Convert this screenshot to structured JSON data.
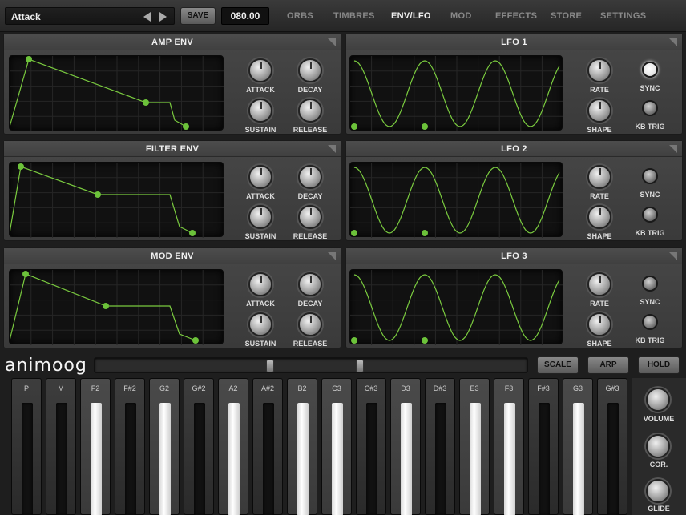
{
  "preset": {
    "name": "Attack"
  },
  "save_label": "SAVE",
  "bpm": "080.00",
  "tabs": [
    {
      "label": "ORBS",
      "active": false
    },
    {
      "label": "TIMBRES",
      "active": false
    },
    {
      "label": "ENV/LFO",
      "active": true
    },
    {
      "label": "MOD",
      "active": false
    },
    {
      "label": "EFFECTS",
      "active": false
    },
    {
      "label": "STORE",
      "active": false
    },
    {
      "label": "SETTINGS",
      "active": false
    }
  ],
  "envs": [
    {
      "title": "AMP ENV",
      "knobs": [
        "ATTACK",
        "DECAY",
        "SUSTAIN",
        "RELEASE"
      ]
    },
    {
      "title": "FILTER ENV",
      "knobs": [
        "ATTACK",
        "DECAY",
        "SUSTAIN",
        "RELEASE"
      ]
    },
    {
      "title": "MOD ENV",
      "knobs": [
        "ATTACK",
        "DECAY",
        "SUSTAIN",
        "RELEASE"
      ]
    }
  ],
  "lfos": [
    {
      "title": "LFO 1",
      "knobs": [
        "RATE",
        "SHAPE"
      ],
      "buttons": [
        "SYNC",
        "KB TRIG"
      ],
      "sync_on": true
    },
    {
      "title": "LFO 2",
      "knobs": [
        "RATE",
        "SHAPE"
      ],
      "buttons": [
        "SYNC",
        "KB TRIG"
      ],
      "sync_on": false
    },
    {
      "title": "LFO 3",
      "knobs": [
        "RATE",
        "SHAPE"
      ],
      "buttons": [
        "SYNC",
        "KB TRIG"
      ],
      "sync_on": false
    }
  ],
  "logo": "animoog Z",
  "bottom_buttons": [
    "SCALE",
    "ARP",
    "HOLD"
  ],
  "keys": [
    {
      "label": "P",
      "light": false
    },
    {
      "label": "M",
      "light": false
    },
    {
      "label": "F2",
      "light": true
    },
    {
      "label": "F#2",
      "light": false
    },
    {
      "label": "G2",
      "light": true
    },
    {
      "label": "G#2",
      "light": false
    },
    {
      "label": "A2",
      "light": true
    },
    {
      "label": "A#2",
      "light": false
    },
    {
      "label": "B2",
      "light": true
    },
    {
      "label": "C3",
      "light": true
    },
    {
      "label": "C#3",
      "light": false
    },
    {
      "label": "D3",
      "light": true
    },
    {
      "label": "D#3",
      "light": false
    },
    {
      "label": "E3",
      "light": true
    },
    {
      "label": "F3",
      "light": true
    },
    {
      "label": "F#3",
      "light": false
    },
    {
      "label": "G3",
      "light": true
    },
    {
      "label": "G#3",
      "light": false
    }
  ],
  "side_knobs": [
    "VOLUME",
    "COR.",
    "GLIDE"
  ],
  "colors": {
    "accent": "#6cc23a",
    "curve": "#7acb3f"
  }
}
